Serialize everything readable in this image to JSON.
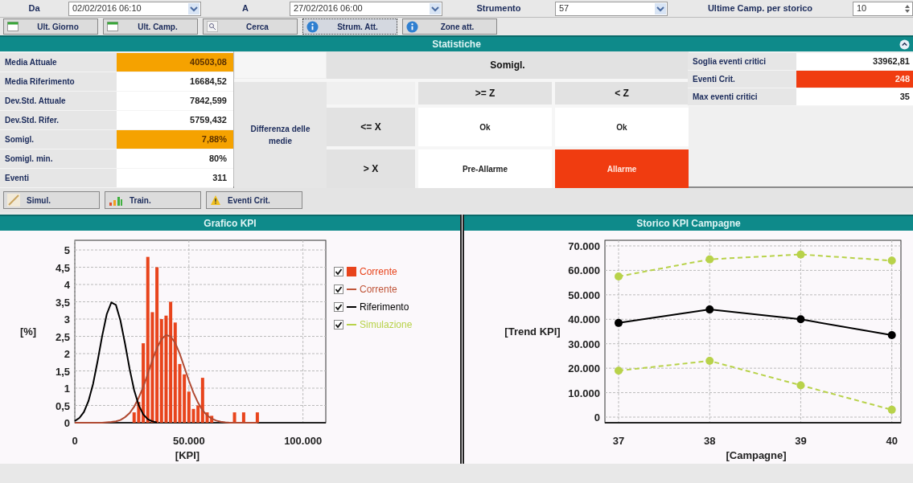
{
  "filters": [
    {
      "kind": "dropdown",
      "label": "Da",
      "value": "02/02/2016 06:10"
    },
    {
      "kind": "dropdown",
      "label": "A",
      "value": "27/02/2016 06:00"
    },
    {
      "kind": "dropdown",
      "label": "Strumento",
      "value": "57"
    },
    {
      "kind": "spinner",
      "label": "Ultime Camp. per storico",
      "value": "10"
    }
  ],
  "toolbar": [
    {
      "label": "Ult. Giorno",
      "kind": "calendar",
      "selected": false
    },
    {
      "label": "Ult. Camp.",
      "kind": "calendar",
      "selected": false
    },
    {
      "label": "Cerca",
      "kind": "search",
      "selected": false
    },
    {
      "label": "Strum. Att.",
      "kind": "info",
      "selected": true
    },
    {
      "label": "Zone att.",
      "kind": "info",
      "selected": false
    }
  ],
  "statistics": {
    "title": "Statistiche",
    "metrics": [
      {
        "label": "Media Attuale",
        "value": "40503,08",
        "color": "#f5a200"
      },
      {
        "label": "Media Riferimento",
        "value": "16684,52",
        "color": "#ffffff"
      },
      {
        "label": "Dev.Std. Attuale",
        "value": "7842,599",
        "color": "#ffffff"
      },
      {
        "label": "Dev.Std. Rifer.",
        "value": "5759,432",
        "color": "#ffffff"
      },
      {
        "label": "Somigl.",
        "value": "7,88%",
        "color": "#f5a200"
      },
      {
        "label": "Somigl. min.",
        "value": "80%",
        "color": "#ffffff"
      },
      {
        "label": "Eventi",
        "value": "311",
        "color": "#ffffff"
      }
    ],
    "matrix": {
      "row_group": "Differenza delle medie",
      "column_group": "Somigl.",
      "columns": [
        ">= Z",
        "< Z"
      ],
      "rows": [
        {
          "label": "<= X",
          "cells": [
            {
              "text": "Ok",
              "color": "#ffffff"
            },
            {
              "text": "Ok",
              "color": "#ffffff"
            }
          ]
        },
        {
          "label": "> X",
          "cells": [
            {
              "text": "Pre-Allarme",
              "color": "#ffffff"
            },
            {
              "text": "Allarme",
              "color": "#f03c10"
            }
          ]
        }
      ]
    },
    "critical": [
      {
        "label": "Soglia eventi critici",
        "value": "33962,81",
        "color": "#ffffff"
      },
      {
        "label": "Eventi Crit.",
        "value": "248",
        "color": "#f03c10"
      },
      {
        "label": "Max eventi critici",
        "value": "35",
        "color": "#ffffff"
      }
    ]
  },
  "actions": [
    {
      "label": "Simul.",
      "kind": "pencil"
    },
    {
      "label": "Train.",
      "kind": "bars"
    },
    {
      "label": "Eventi Crit.",
      "kind": "warning"
    }
  ],
  "charts": [
    {
      "title": "Grafico KPI",
      "legend": [
        {
          "label": "Corrente",
          "kind": "bar",
          "checked": true,
          "color": "#e8441c"
        },
        {
          "label": "Corrente",
          "kind": "line",
          "checked": true,
          "color": "#c0563a"
        },
        {
          "label": "Riferimento",
          "kind": "line",
          "checked": true,
          "color": "#000000"
        },
        {
          "label": "Simulazione",
          "kind": "line",
          "checked": true,
          "color": "#b8d24a"
        }
      ],
      "chart_data": {
        "type": "bar",
        "grid": true,
        "xlabel": "[KPI]",
        "ylabel": "[%]",
        "xlim": [
          0,
          110000
        ],
        "ylim": [
          0,
          5.28
        ],
        "xticks": [
          0,
          {
            "value": 50000,
            "label": "50.000"
          },
          {
            "value": 100000,
            "label": "100.000"
          }
        ],
        "yticks": [
          0,
          {
            "value": 0.5,
            "label": "0,5"
          },
          1,
          {
            "value": 1.5,
            "label": "1,5"
          },
          2,
          {
            "value": 2.5,
            "label": "2,5"
          },
          3,
          {
            "value": 3.5,
            "label": "3,5"
          },
          4,
          {
            "value": 4.5,
            "label": "4,5"
          },
          5
        ],
        "x": [
          0,
          2000,
          4000,
          6000,
          8000,
          10000,
          12000,
          14000,
          16000,
          18000,
          20000,
          22000,
          24000,
          26000,
          28000,
          30000,
          32000,
          34000,
          36000,
          38000,
          40000,
          42000,
          44000,
          46000,
          48000,
          50000,
          52000,
          54000,
          56000,
          58000,
          60000,
          62000,
          64000,
          66000,
          68000,
          70000,
          72000,
          74000,
          76000,
          78000,
          80000
        ],
        "series": [
          {
            "color": "#e8441c",
            "values": [
              null,
              null,
              null,
              null,
              null,
              null,
              null,
              null,
              null,
              null,
              null,
              null,
              null,
              0.3,
              0.6,
              2.3,
              4.8,
              3.2,
              4.5,
              3.0,
              3.1,
              3.5,
              2.9,
              1.7,
              1.4,
              0.9,
              0.4,
              0.5,
              1.3,
              0.3,
              0.2,
              null,
              null,
              null,
              null,
              0.3,
              null,
              0.3,
              null,
              null,
              0.3
            ]
          },
          {
            "type": "line",
            "color": "#b04a32",
            "values": [
              0,
              0,
              0,
              0,
              0,
              0,
              0,
              0.01,
              0.02,
              0.04,
              0.08,
              0.16,
              0.28,
              0.46,
              0.72,
              1.04,
              1.42,
              1.81,
              2.16,
              2.42,
              2.54,
              2.5,
              2.31,
              1.99,
              1.61,
              1.22,
              0.87,
              0.58,
              0.36,
              0.21,
              0.12,
              0.06,
              0.03,
              0.01,
              0,
              0,
              0,
              0,
              0,
              0,
              0
            ]
          },
          {
            "type": "line",
            "color": "#000000",
            "values": [
              0.05,
              0.14,
              0.31,
              0.63,
              1.12,
              1.79,
              2.51,
              3.14,
              3.48,
              3.41,
              2.96,
              2.29,
              1.56,
              0.95,
              0.51,
              0.24,
              0.1,
              0.04,
              0.01,
              null,
              null,
              null,
              null,
              null,
              null,
              null,
              null,
              null,
              null,
              null,
              null,
              null,
              null,
              null,
              null,
              null,
              null,
              null,
              null,
              null,
              null
            ]
          }
        ]
      }
    },
    {
      "title": "Storico KPI Campagne",
      "chart_data": {
        "type": "line",
        "grid": true,
        "xlabel": "[Campagne]",
        "ylabel": "[Trend KPI]",
        "xlim": [
          36.85,
          40.1
        ],
        "ylim": [
          -2300,
          72300
        ],
        "xticks": [
          37,
          38,
          39,
          40
        ],
        "yticks": [
          0,
          {
            "value": 10000,
            "label": "10.000"
          },
          {
            "value": 20000,
            "label": "20.000"
          },
          {
            "value": 30000,
            "label": "30.000"
          },
          {
            "value": 40000,
            "label": "40.000"
          },
          {
            "value": 50000,
            "label": "50.000"
          },
          {
            "value": 60000,
            "label": "60.000"
          },
          {
            "value": 70000,
            "label": "70.000"
          }
        ],
        "x": [
          37,
          38,
          39,
          40
        ],
        "series": [
          {
            "line_style": "dashed",
            "marker": "circle",
            "color": "#b8d24a",
            "values": [
              57500,
              64500,
              66500,
              64000
            ]
          },
          {
            "line_style": "solid",
            "marker": "circle",
            "color": "#000000",
            "values": [
              38500,
              44000,
              40000,
              33500
            ]
          },
          {
            "line_style": "dashed",
            "marker": "circle",
            "color": "#b8d24a",
            "values": [
              19000,
              23000,
              13000,
              3000
            ]
          }
        ]
      }
    }
  ]
}
